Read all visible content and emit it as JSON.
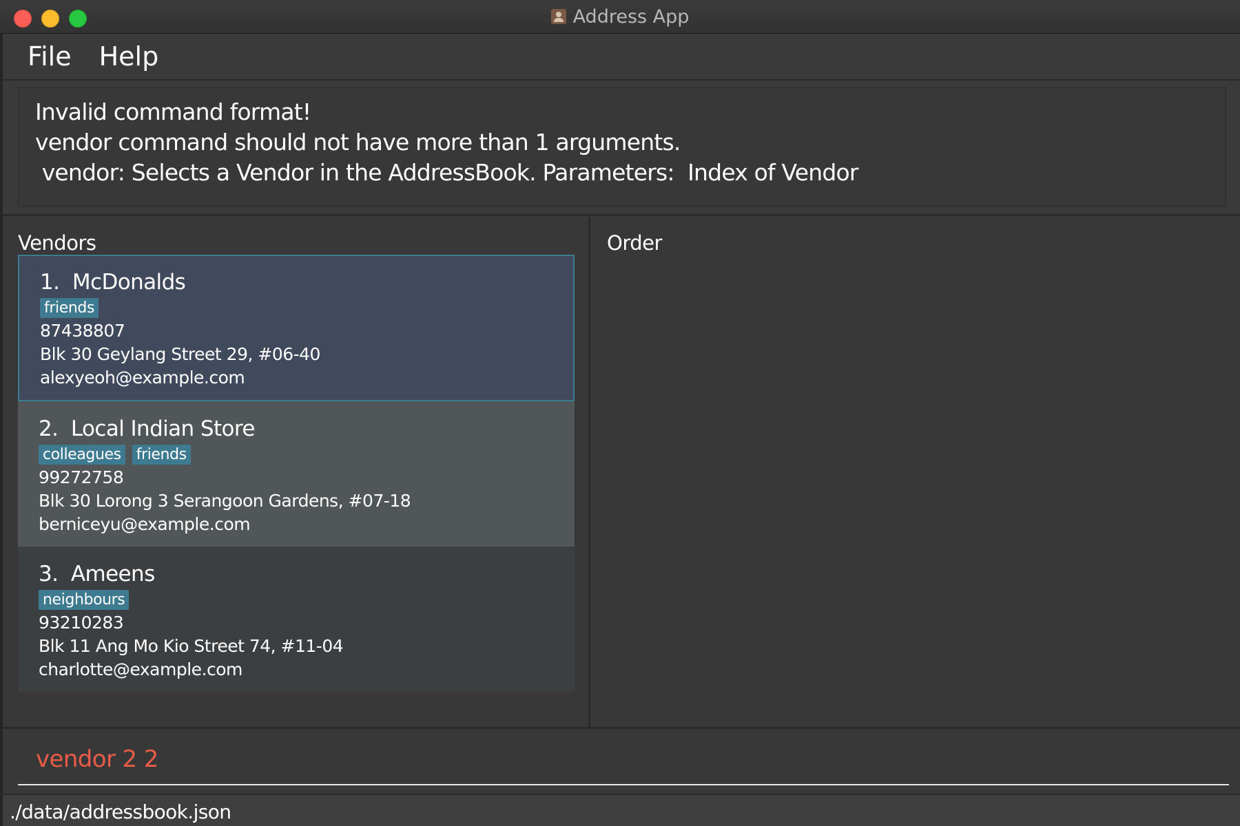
{
  "window": {
    "title": "Address App"
  },
  "menu": {
    "items": [
      "File",
      "Help"
    ]
  },
  "result": {
    "lines": [
      "Invalid command format!",
      "vendor command should not have more than 1 arguments.",
      " vendor: Selects a Vendor in the AddressBook. Parameters:  Index of Vendor"
    ]
  },
  "vendors_panel": {
    "title": "Vendors",
    "vendors": [
      {
        "name": "1.  McDonalds",
        "tags": [
          "friends"
        ],
        "phone": "87438807",
        "address": "Blk 30 Geylang Street 29, #06-40",
        "email": "alexyeoh@example.com",
        "selected": true
      },
      {
        "name": "2.  Local Indian Store",
        "tags": [
          "colleagues",
          "friends"
        ],
        "phone": "99272758",
        "address": "Blk 30 Lorong 3 Serangoon Gardens, #07-18",
        "email": "berniceyu@example.com",
        "selected": false
      },
      {
        "name": "3.  Ameens",
        "tags": [
          "neighbours"
        ],
        "phone": "93210283",
        "address": "Blk 11 Ang Mo Kio Street 74, #11-04",
        "email": "charlotte@example.com",
        "selected": false
      }
    ]
  },
  "order_panel": {
    "title": "Order"
  },
  "command": {
    "value": "vendor 2 2",
    "error_color": "#ea5b48"
  },
  "status": {
    "path": "./data/addressbook.json"
  },
  "colors": {
    "tag_bg": "#3e7b91",
    "selected_card_bg": "#404a5c",
    "selected_border": "#3c7d93"
  }
}
